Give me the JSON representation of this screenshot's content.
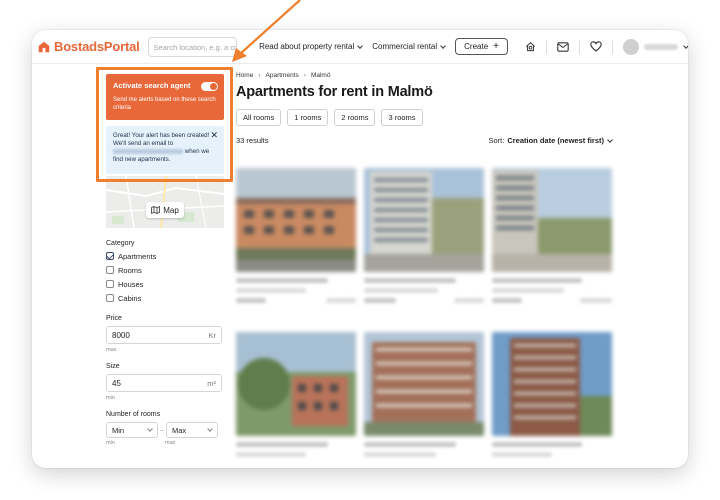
{
  "header": {
    "logo_text": "BostadsPortal",
    "search_placeholder": "Search location, e.g. a city or area",
    "nav": [
      {
        "label": "Read about property rental"
      },
      {
        "label": "Commercial rental"
      }
    ],
    "create_label": "Create",
    "icons": [
      "home-search-icon",
      "mail-icon",
      "heart-icon"
    ]
  },
  "sidebar": {
    "agent": {
      "title": "Activate search agent",
      "subtitle": "Send me alerts based on these search criteria",
      "toggle_on": true
    },
    "alert": {
      "text_1": "Great! Your alert has been created! We'll send an email to",
      "text_2": "when we find new apartments."
    },
    "map_label": "Map"
  },
  "filters": {
    "category_label": "Category",
    "categories": [
      {
        "label": "Apartments",
        "checked": true
      },
      {
        "label": "Rooms",
        "checked": false
      },
      {
        "label": "Houses",
        "checked": false
      },
      {
        "label": "Cabins",
        "checked": false
      }
    ],
    "price": {
      "label": "Price",
      "value": "8000",
      "unit": "Kr",
      "hint": "max"
    },
    "size": {
      "label": "Size",
      "value": "45",
      "unit": "m²",
      "hint": "min"
    },
    "rooms": {
      "label": "Number of rooms",
      "min_value": "Min",
      "max_value": "Max",
      "min_hint": "min",
      "max_hint": "max"
    }
  },
  "main": {
    "breadcrumb": [
      "Home",
      "Apartments",
      "Malmö"
    ],
    "title": "Apartments for rent in Malmö",
    "room_tabs": [
      "All rooms",
      "1 rooms",
      "2 rooms",
      "3 rooms"
    ],
    "results": "33 results",
    "sort_label": "Sort:",
    "sort_value": "Creation date (newest first)"
  },
  "colors": {
    "brand": "#e8683a",
    "highlight": "#ee7f2d",
    "alert_bg": "#e5f1fb"
  }
}
